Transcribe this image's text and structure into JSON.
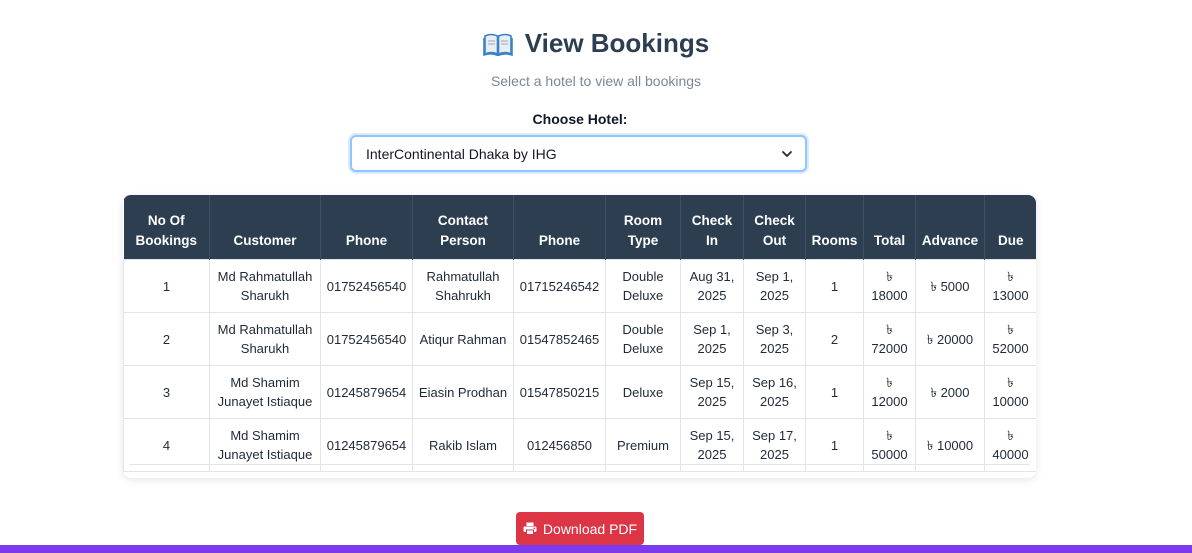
{
  "header": {
    "title": "View Bookings",
    "subtitle": "Select a hotel to view all bookings",
    "icon": "open-book-icon"
  },
  "hotel_select": {
    "label": "Choose Hotel:",
    "selected": "InterContinental Dhaka by IHG"
  },
  "table": {
    "columns": [
      [
        "No Of",
        "Bookings"
      ],
      [
        "Customer"
      ],
      [
        "Phone"
      ],
      [
        "Contact",
        "Person"
      ],
      [
        "Phone"
      ],
      [
        "Room",
        "Type"
      ],
      [
        "Check",
        "In"
      ],
      [
        "Check",
        "Out"
      ],
      [
        "Rooms"
      ],
      [
        "Total"
      ],
      [
        "Advance"
      ],
      [
        "Due"
      ]
    ],
    "rows": [
      [
        [
          "1"
        ],
        [
          "Md Rahmatullah",
          "Sharukh"
        ],
        [
          "01752456540"
        ],
        [
          "Rahmatullah",
          "Shahrukh"
        ],
        [
          "01715246542"
        ],
        [
          "Double",
          "Deluxe"
        ],
        [
          "Aug 31,",
          "2025"
        ],
        [
          "Sep 1,",
          "2025"
        ],
        [
          "1"
        ],
        [
          "৳",
          "18000"
        ],
        [
          "৳ 5000"
        ],
        [
          "৳",
          "13000"
        ]
      ],
      [
        [
          "2"
        ],
        [
          "Md Rahmatullah",
          "Sharukh"
        ],
        [
          "01752456540"
        ],
        [
          "Atiqur Rahman"
        ],
        [
          "01547852465"
        ],
        [
          "Double",
          "Deluxe"
        ],
        [
          "Sep 1,",
          "2025"
        ],
        [
          "Sep 3,",
          "2025"
        ],
        [
          "2"
        ],
        [
          "৳",
          "72000"
        ],
        [
          "৳ 20000"
        ],
        [
          "৳",
          "52000"
        ]
      ],
      [
        [
          "3"
        ],
        [
          "Md Shamim",
          "Junayet Istiaque"
        ],
        [
          "01245879654"
        ],
        [
          "Eiasin Prodhan"
        ],
        [
          "01547850215"
        ],
        [
          "Deluxe"
        ],
        [
          "Sep 15,",
          "2025"
        ],
        [
          "Sep 16,",
          "2025"
        ],
        [
          "1"
        ],
        [
          "৳",
          "12000"
        ],
        [
          "৳ 2000"
        ],
        [
          "৳",
          "10000"
        ]
      ],
      [
        [
          "4"
        ],
        [
          "Md Shamim",
          "Junayet Istiaque"
        ],
        [
          "01245879654"
        ],
        [
          "Rakib Islam"
        ],
        [
          "012456850"
        ],
        [
          "Premium"
        ],
        [
          "Sep 15,",
          "2025"
        ],
        [
          "Sep 17,",
          "2025"
        ],
        [
          "1"
        ],
        [
          "৳",
          "50000"
        ],
        [
          "৳ 10000"
        ],
        [
          "৳",
          "40000"
        ]
      ]
    ]
  },
  "actions": {
    "download_pdf_label": "Download PDF",
    "download_pdf_icon": "printer-icon",
    "download_pdf_color": "#dc3545"
  },
  "colors": {
    "header_bg": "#2c3e50",
    "title": "#2c3e50",
    "bottom_bar": "#7c3aed",
    "select_border": "#93c5fd"
  }
}
